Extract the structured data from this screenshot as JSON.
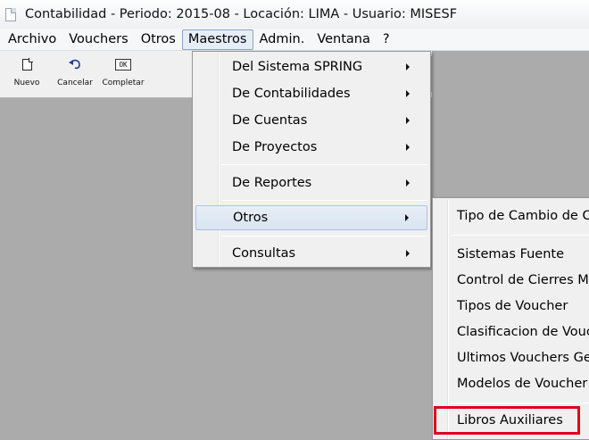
{
  "window": {
    "title": "Contabilidad  - Periodo: 2015-08 - Locación: LIMA - Usuario: MISESF"
  },
  "menubar": {
    "items": [
      "Archivo",
      "Vouchers",
      "Otros",
      "Maestros",
      "Admin.",
      "Ventana",
      "?"
    ],
    "active": "Maestros"
  },
  "toolbar": {
    "buttons": [
      {
        "label": "Nuevo",
        "icon": "new-document-icon"
      },
      {
        "label": "Cancelar",
        "icon": "undo-icon"
      },
      {
        "label": "Completar",
        "icon": "ok-icon",
        "icon_text": "OK"
      }
    ]
  },
  "maestros_menu": {
    "items": [
      {
        "label": "Del Sistema SPRING",
        "submenu": true
      },
      {
        "label": "De Contabilidades",
        "submenu": true
      },
      {
        "label": "De Cuentas",
        "submenu": true
      },
      {
        "label": "De Proyectos",
        "submenu": true
      },
      {
        "label": "De Reportes",
        "submenu": true
      },
      {
        "label": "Otros",
        "submenu": true,
        "highlighted": true
      },
      {
        "label": "Consultas",
        "submenu": true
      }
    ]
  },
  "otros_submenu": {
    "items": [
      "Tipo de Cambio de C",
      "Sistemas Fuente",
      "Control de Cierres Me",
      "Tipos de Voucher",
      "Clasificacion de Vouc",
      "Ultimos Vouchers Ge",
      "Modelos de Voucher",
      "Libros Auxiliares"
    ],
    "selected": "Libros Auxiliares",
    "highlight_color": "#e0001b"
  }
}
